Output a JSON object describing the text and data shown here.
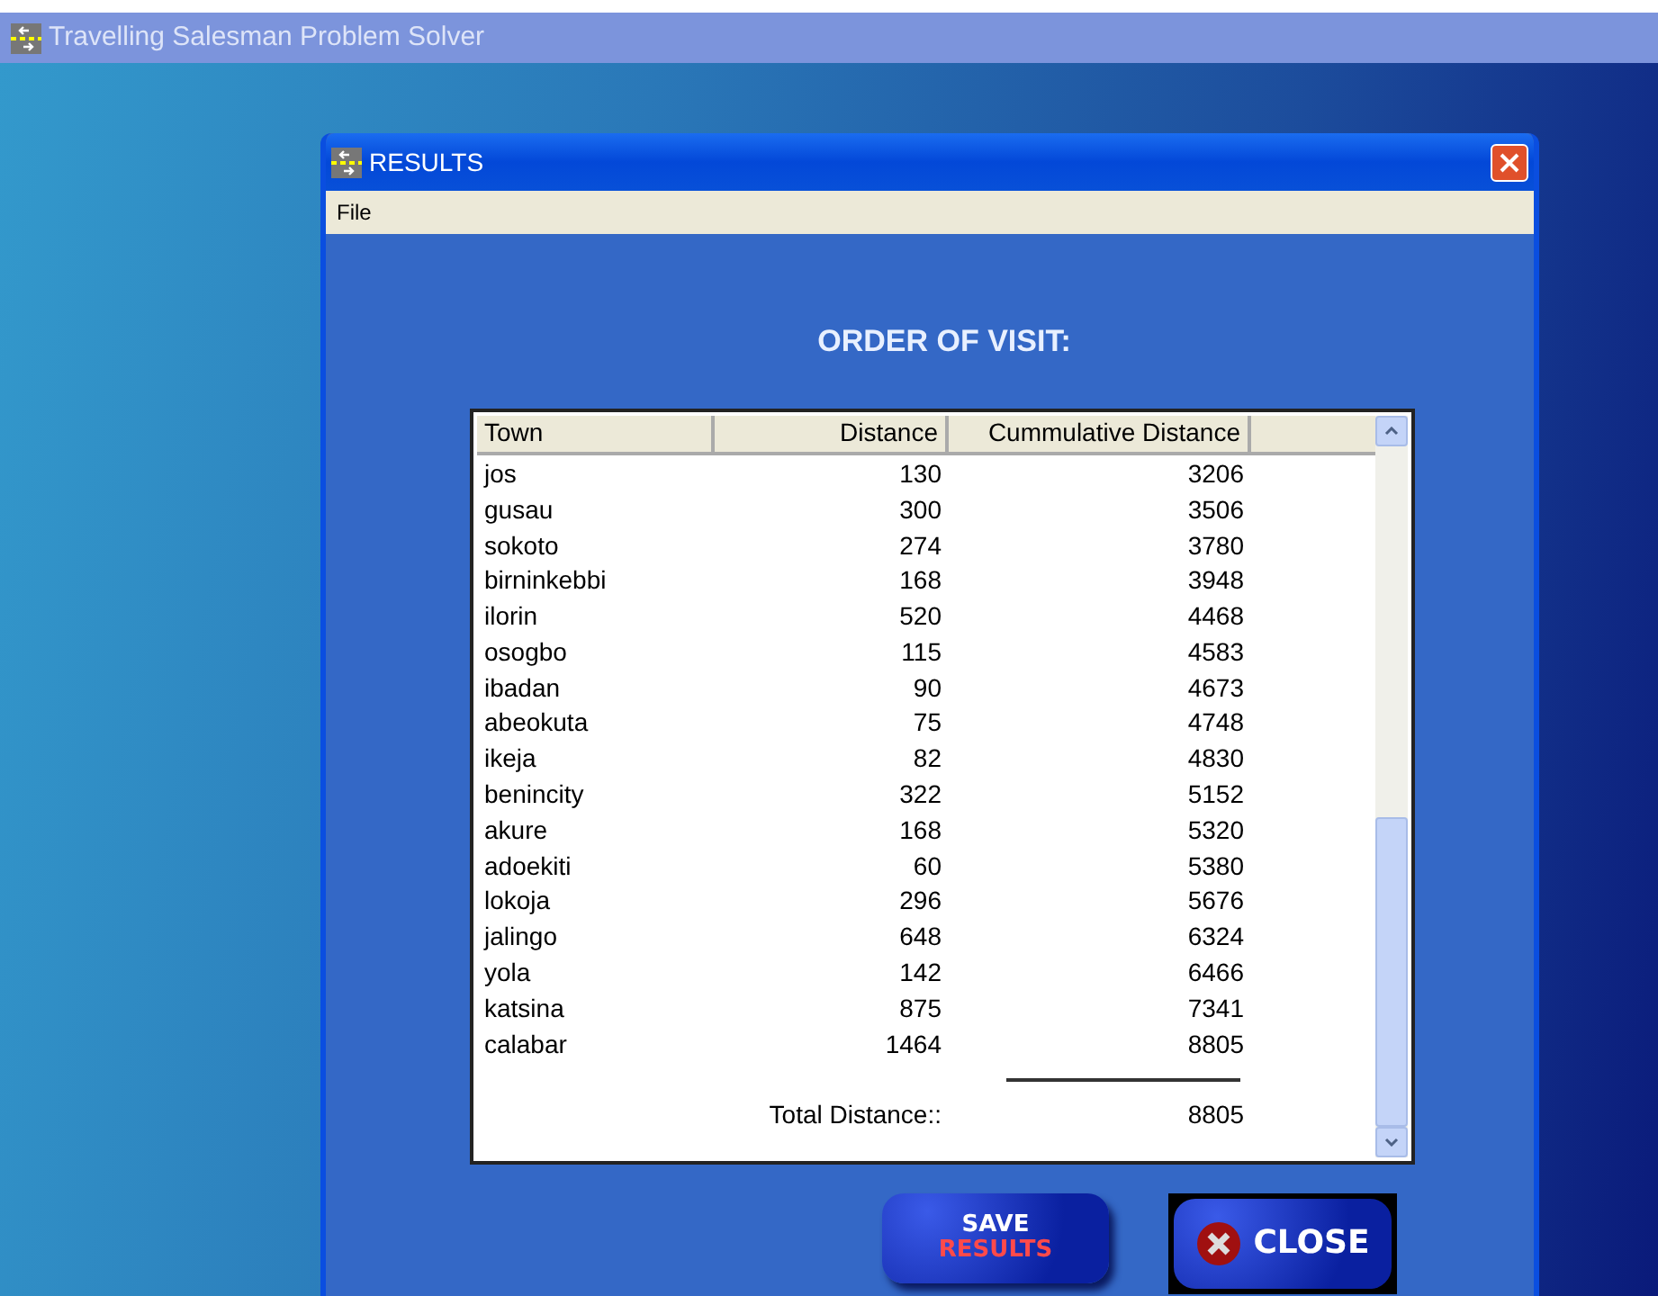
{
  "app_window": {
    "title": "Travelling Salesman Problem Solver"
  },
  "dialog": {
    "title": "RESULTS",
    "menu": [
      "File"
    ]
  },
  "heading": "ORDER OF VISIT:",
  "table": {
    "columns": [
      "Town",
      "Distance",
      "Cummulative Distance"
    ],
    "rows": [
      [
        "jos",
        "130",
        "3206"
      ],
      [
        "gusau",
        "300",
        "3506"
      ],
      [
        "sokoto",
        "274",
        "3780"
      ],
      [
        "birninkebbi",
        "168",
        "3948"
      ],
      [
        "ilorin",
        "520",
        "4468"
      ],
      [
        "osogbo",
        "115",
        "4583"
      ],
      [
        "ibadan",
        "90",
        "4673"
      ],
      [
        "abeokuta",
        "75",
        "4748"
      ],
      [
        "ikeja",
        "82",
        "4830"
      ],
      [
        "benincity",
        "322",
        "5152"
      ],
      [
        "akure",
        "168",
        "5320"
      ],
      [
        "adoekiti",
        "60",
        "5380"
      ],
      [
        "lokoja",
        "296",
        "5676"
      ],
      [
        "jalingo",
        "648",
        "6324"
      ],
      [
        "yola",
        "142",
        "6466"
      ],
      [
        "katsina",
        "875",
        "7341"
      ],
      [
        "calabar",
        "1464",
        "8805"
      ]
    ],
    "total": {
      "label": "Total Distance::",
      "value": "8805"
    }
  },
  "buttons": [
    {
      "kind": "save",
      "lines": [
        "SAVE",
        "RESULTS"
      ]
    },
    {
      "kind": "close",
      "label": "CLOSE"
    }
  ]
}
